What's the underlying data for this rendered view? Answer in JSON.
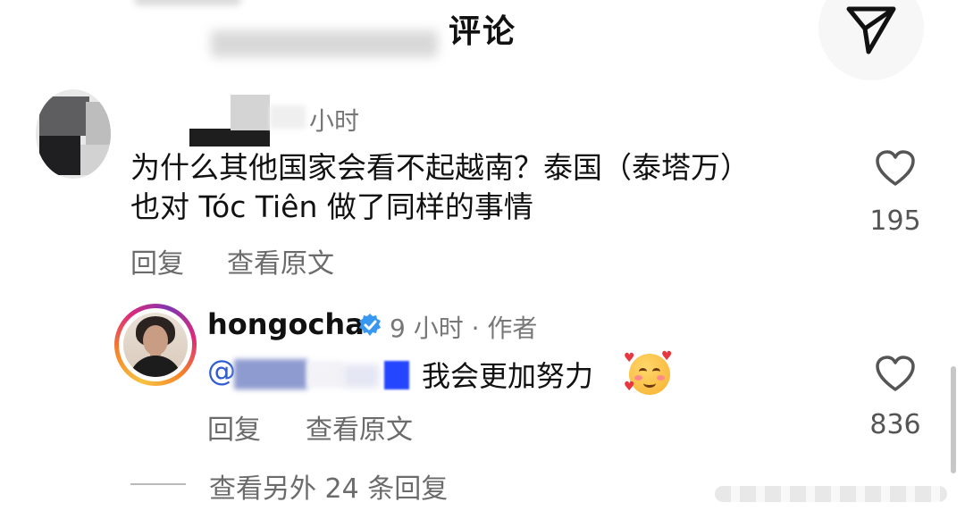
{
  "header": {
    "title": "评论"
  },
  "comments": [
    {
      "time": "小时",
      "text_line1": "为什么其他国家会看不起越南？泰国（泰塔万）",
      "text_line2": "也对 Tóc Tiên 做了同样的事情",
      "likes": "195",
      "reply_label": "回复",
      "view_original_label": "查看原文"
    }
  ],
  "reply": {
    "username": "hongocha",
    "time": "9 小时 · 作者",
    "mention_prefix": "@",
    "text": "我会更加努力",
    "emoji": "smiling-face-with-hearts",
    "likes": "836",
    "reply_label": "回复",
    "view_original_label": "查看原文"
  },
  "more_replies": "查看另外 24 条回复",
  "colors": {
    "link": "#2f5bd3",
    "verified": "#3897f0",
    "muted_text": "#6b6b6b"
  }
}
